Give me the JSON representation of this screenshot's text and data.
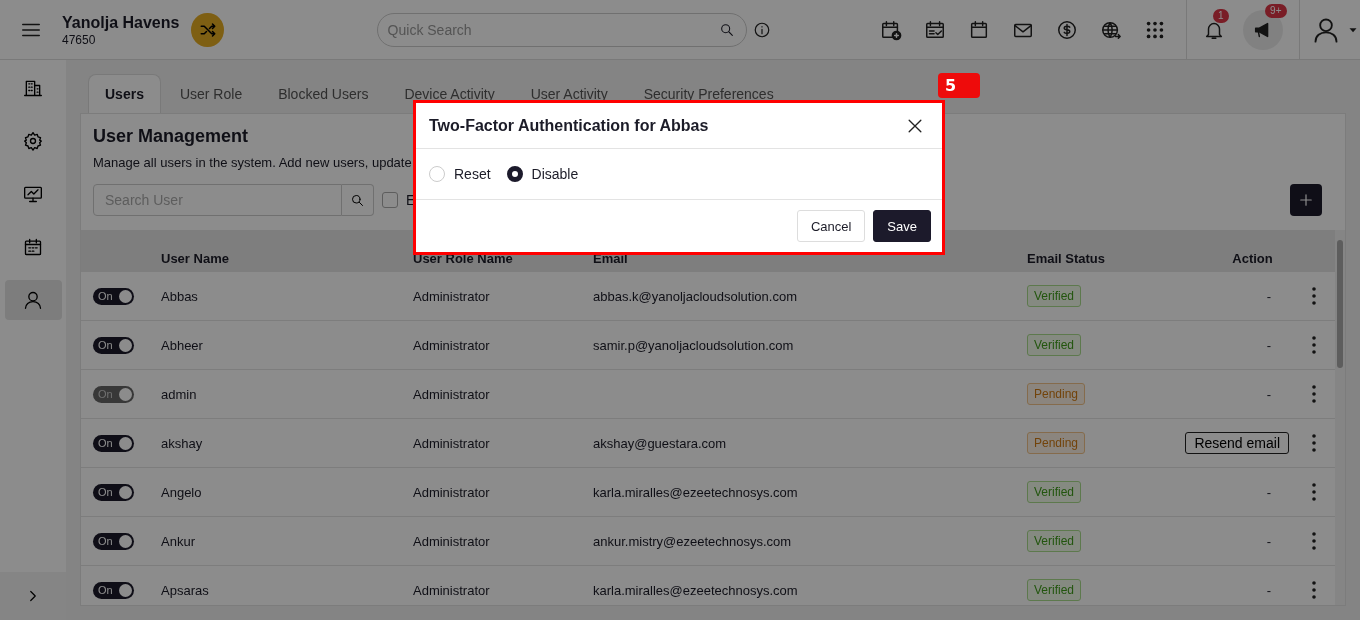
{
  "app": {
    "title": "Yanolja Havens",
    "code": "47650"
  },
  "search": {
    "placeholder": "Quick Search"
  },
  "notifications": {
    "badge": "1"
  },
  "announcements": {
    "badge": "9+"
  },
  "sidebar": {
    "items": [
      {
        "kind": "building",
        "selected": false
      },
      {
        "kind": "gear",
        "selected": false
      },
      {
        "kind": "monitor",
        "selected": false
      },
      {
        "kind": "calendar",
        "selected": false
      },
      {
        "kind": "user",
        "selected": true
      }
    ]
  },
  "tabs": [
    {
      "label": "Users",
      "selected": true
    },
    {
      "label": "User Role",
      "selected": false
    },
    {
      "label": "Blocked Users",
      "selected": false
    },
    {
      "label": "Device Activity",
      "selected": false
    },
    {
      "label": "User Activity",
      "selected": false
    },
    {
      "label": "Security Preferences",
      "selected": false
    }
  ],
  "step_badge": "5",
  "page": {
    "title": "User Management",
    "description": "Manage all users in the system. Add new users, update",
    "search_placeholder": "Search User",
    "checkbox": {
      "label": "E",
      "checked": false
    }
  },
  "table": {
    "columns": [
      "User Name",
      "User Role Name",
      "Email",
      "Email Status",
      "Action"
    ],
    "rows": [
      {
        "toggle": {
          "label": "On",
          "on": true,
          "disabled": false
        },
        "name": "Abbas",
        "role": "Administrator",
        "email": "abbas.k@yanoljacloudsolution.com",
        "email_status": {
          "label": "Verified",
          "kind": "verified"
        },
        "action": {
          "kind": "text",
          "label": "-"
        }
      },
      {
        "toggle": {
          "label": "On",
          "on": true,
          "disabled": false
        },
        "name": "Abheer",
        "role": "Administrator",
        "email": "samir.p@yanoljacloudsolution.com",
        "email_status": {
          "label": "Verified",
          "kind": "verified"
        },
        "action": {
          "kind": "text",
          "label": "-"
        }
      },
      {
        "toggle": {
          "label": "On",
          "on": true,
          "disabled": true
        },
        "name": "admin",
        "role": "Administrator",
        "email_status": {
          "label": "Pending",
          "kind": "pending"
        },
        "action": {
          "kind": "text",
          "label": "-"
        }
      },
      {
        "toggle": {
          "label": "On",
          "on": true,
          "disabled": false
        },
        "name": "akshay",
        "role": "Administrator",
        "email": "akshay@guestara.com",
        "email_status": {
          "label": "Pending",
          "kind": "pending"
        },
        "action": {
          "kind": "button",
          "label": "Resend email"
        }
      },
      {
        "toggle": {
          "label": "On",
          "on": true,
          "disabled": false
        },
        "name": "Angelo",
        "role": "Administrator",
        "email": "karla.miralles@ezeetechnosys.com",
        "email_status": {
          "label": "Verified",
          "kind": "verified"
        },
        "action": {
          "kind": "text",
          "label": "-"
        }
      },
      {
        "toggle": {
          "label": "On",
          "on": true,
          "disabled": false
        },
        "name": "Ankur",
        "role": "Administrator",
        "email": "ankur.mistry@ezeetechnosys.com",
        "email_status": {
          "label": "Verified",
          "kind": "verified"
        },
        "action": {
          "kind": "text",
          "label": "-"
        }
      },
      {
        "toggle": {
          "label": "On",
          "on": true,
          "disabled": false
        },
        "name": "Apsaras",
        "role": "Administrator",
        "email": "karla.miralles@ezeetechnosys.com",
        "email_status": {
          "label": "Verified",
          "kind": "verified"
        },
        "action": {
          "kind": "text",
          "label": "-"
        }
      }
    ]
  },
  "dialog": {
    "title": "Two-Factor Authentication for Abbas",
    "options": [
      {
        "label": "Reset",
        "selected": false
      },
      {
        "label": "Disable",
        "selected": true
      }
    ],
    "buttons": [
      {
        "label": "Cancel",
        "kind": "secondary"
      },
      {
        "label": "Save",
        "kind": "primary"
      }
    ]
  }
}
